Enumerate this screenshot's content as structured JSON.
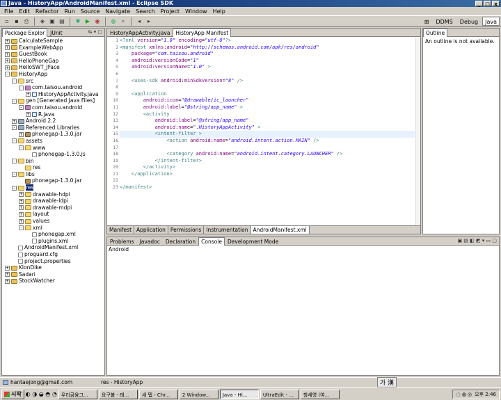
{
  "window": {
    "title": "Java - HistoryApp/AndroidManifest.xml - Eclipse SDK",
    "min": "_",
    "max": "□",
    "close": "x"
  },
  "menu": [
    "File",
    "Edit",
    "Refactor",
    "Run",
    "Source",
    "Navigate",
    "Search",
    "Project",
    "Window",
    "Help"
  ],
  "perspectives": [
    {
      "label": "DDMS",
      "active": false
    },
    {
      "label": "Debug",
      "active": false
    },
    {
      "label": "Java",
      "active": true
    }
  ],
  "package_explorer": {
    "tabs": [
      "Package Explor",
      "JUnit"
    ],
    "tree": [
      {
        "label": "CalculateSample",
        "icon": "proj",
        "depth": 0,
        "exp": "+"
      },
      {
        "label": "ExampleWebApp",
        "icon": "proj",
        "depth": 0,
        "exp": "+"
      },
      {
        "label": "GuestBook",
        "icon": "proj",
        "depth": 0,
        "exp": "+"
      },
      {
        "label": "HelloPhoneGap",
        "icon": "proj",
        "depth": 0,
        "exp": "+"
      },
      {
        "label": "HelloSWT_JFace",
        "icon": "proj",
        "depth": 0,
        "exp": "+"
      },
      {
        "label": "HistoryApp",
        "icon": "proj",
        "depth": 0,
        "exp": "-"
      },
      {
        "label": "src",
        "icon": "folder",
        "depth": 1,
        "exp": "-"
      },
      {
        "label": "com.taisou.android",
        "icon": "pkg",
        "depth": 2,
        "exp": "-"
      },
      {
        "label": "HistoryAppActivity.java",
        "icon": "java",
        "depth": 3,
        "exp": "+"
      },
      {
        "label": "gen [Generated Java Files]",
        "icon": "folder",
        "depth": 1,
        "exp": "-"
      },
      {
        "label": "com.taisou.android",
        "icon": "pkg",
        "depth": 2,
        "exp": "-"
      },
      {
        "label": "R.java",
        "icon": "java",
        "depth": 3,
        "exp": "+"
      },
      {
        "label": "Android 2.2",
        "icon": "lib",
        "depth": 1,
        "exp": "+"
      },
      {
        "label": "Referenced Libraries",
        "icon": "lib",
        "depth": 1,
        "exp": "-"
      },
      {
        "label": "phonegap-1.3.0.jar",
        "icon": "jar",
        "depth": 2,
        "exp": "+"
      },
      {
        "label": "assets",
        "icon": "folder",
        "depth": 1,
        "exp": "-"
      },
      {
        "label": "www",
        "icon": "folder",
        "depth": 2,
        "exp": "-"
      },
      {
        "label": "phonegap-1.3.0.js",
        "icon": "file",
        "depth": 3,
        "exp": ""
      },
      {
        "label": "bin",
        "icon": "folder",
        "depth": 1,
        "exp": "-"
      },
      {
        "label": "res",
        "icon": "folder",
        "depth": 2,
        "exp": ""
      },
      {
        "label": "libs",
        "icon": "folder",
        "depth": 1,
        "exp": "-"
      },
      {
        "label": "phonegap-1.3.0.jar",
        "icon": "jar",
        "depth": 2,
        "exp": ""
      },
      {
        "label": "res",
        "icon": "folder",
        "depth": 1,
        "exp": "-",
        "selected": true
      },
      {
        "label": "drawable-hdpi",
        "icon": "folder",
        "depth": 2,
        "exp": "+"
      },
      {
        "label": "drawable-ldpi",
        "icon": "folder",
        "depth": 2,
        "exp": "+"
      },
      {
        "label": "drawable-mdpi",
        "icon": "folder",
        "depth": 2,
        "exp": "+"
      },
      {
        "label": "layout",
        "icon": "folder",
        "depth": 2,
        "exp": "+"
      },
      {
        "label": "values",
        "icon": "folder",
        "depth": 2,
        "exp": "+"
      },
      {
        "label": "xml",
        "icon": "folder",
        "depth": 2,
        "exp": "-"
      },
      {
        "label": "phonegap.xml",
        "icon": "file",
        "depth": 3,
        "exp": ""
      },
      {
        "label": "plugins.xml",
        "icon": "file",
        "depth": 3,
        "exp": ""
      },
      {
        "label": "AndroidManifest.xml",
        "icon": "file",
        "depth": 1,
        "exp": ""
      },
      {
        "label": "proguard.cfg",
        "icon": "file",
        "depth": 1,
        "exp": ""
      },
      {
        "label": "project.properties",
        "icon": "file",
        "depth": 1,
        "exp": ""
      },
      {
        "label": "KlonDike",
        "icon": "proj",
        "depth": 0,
        "exp": "+"
      },
      {
        "label": "Sadari",
        "icon": "proj",
        "depth": 0,
        "exp": "+"
      },
      {
        "label": "StockWatcher",
        "icon": "proj",
        "depth": 0,
        "exp": "+"
      }
    ]
  },
  "editor": {
    "tabs": [
      {
        "label": "HistoryAppActivity.java",
        "active": false
      },
      {
        "label": "HistoryApp Manifest",
        "active": true
      }
    ],
    "line_numbers": [
      "1",
      "2",
      "3",
      "4",
      "5",
      "6",
      "7",
      "8",
      "9",
      "10",
      "11",
      "12",
      "13",
      "14",
      "15",
      "16",
      "17",
      "18",
      "19",
      "20",
      "21",
      "22",
      "23"
    ],
    "lines": [
      [
        {
          "t": "<?xml ",
          "c": "pi"
        },
        {
          "t": "version",
          "c": "attr"
        },
        {
          "t": "=",
          "c": ""
        },
        {
          "t": "\"1.0\"",
          "c": "val"
        },
        {
          "t": " ",
          "c": ""
        },
        {
          "t": "encoding",
          "c": "attr"
        },
        {
          "t": "=",
          "c": ""
        },
        {
          "t": "\"utf-8\"",
          "c": "val"
        },
        {
          "t": "?>",
          "c": "pi"
        }
      ],
      [
        {
          "t": "<manifest ",
          "c": "tag"
        },
        {
          "t": "xmlns:android",
          "c": "attr"
        },
        {
          "t": "=",
          "c": ""
        },
        {
          "t": "\"http://schemas.android.com/apk/res/android\"",
          "c": "val"
        }
      ],
      [
        {
          "t": "    package",
          "c": "attr"
        },
        {
          "t": "=",
          "c": ""
        },
        {
          "t": "\"com.taisou.android\"",
          "c": "val"
        }
      ],
      [
        {
          "t": "    android:versionCode",
          "c": "attr"
        },
        {
          "t": "=",
          "c": ""
        },
        {
          "t": "\"1\"",
          "c": "val"
        }
      ],
      [
        {
          "t": "    android:versionName",
          "c": "attr"
        },
        {
          "t": "=",
          "c": ""
        },
        {
          "t": "\"1.0\"",
          "c": "val"
        },
        {
          "t": " >",
          "c": "tag"
        }
      ],
      [],
      [
        {
          "t": "    <uses-sdk ",
          "c": "tag"
        },
        {
          "t": "android:minSdkVersion",
          "c": "attr"
        },
        {
          "t": "=",
          "c": ""
        },
        {
          "t": "\"8\"",
          "c": "val"
        },
        {
          "t": " />",
          "c": "tag"
        }
      ],
      [],
      [
        {
          "t": "    <application",
          "c": "tag"
        }
      ],
      [
        {
          "t": "        android:icon",
          "c": "attr"
        },
        {
          "t": "=",
          "c": ""
        },
        {
          "t": "\"@drawable/ic_launcher\"",
          "c": "val"
        }
      ],
      [
        {
          "t": "        android:label",
          "c": "attr"
        },
        {
          "t": "=",
          "c": ""
        },
        {
          "t": "\"@string/app_name\"",
          "c": "val"
        },
        {
          "t": " >",
          "c": "tag"
        }
      ],
      [
        {
          "t": "        <activity",
          "c": "tag"
        }
      ],
      [
        {
          "t": "            android:label",
          "c": "attr"
        },
        {
          "t": "=",
          "c": ""
        },
        {
          "t": "\"@string/app_name\"",
          "c": "val"
        }
      ],
      [
        {
          "t": "            android:name",
          "c": "attr"
        },
        {
          "t": "=",
          "c": ""
        },
        {
          "t": "\".HistoryAppActivity\"",
          "c": "val"
        },
        {
          "t": " >",
          "c": "tag"
        }
      ],
      [
        {
          "t": "            <intent-filter >",
          "c": "tag"
        }
      ],
      [
        {
          "t": "                <action ",
          "c": "tag"
        },
        {
          "t": "android:name",
          "c": "attr"
        },
        {
          "t": "=",
          "c": ""
        },
        {
          "t": "\"android.intent.action.MAIN\"",
          "c": "val"
        },
        {
          "t": " />",
          "c": "tag"
        }
      ],
      [],
      [
        {
          "t": "                <category ",
          "c": "tag"
        },
        {
          "t": "android:name",
          "c": "attr"
        },
        {
          "t": "=",
          "c": ""
        },
        {
          "t": "\"android.intent.category.LAUNCHER\"",
          "c": "val"
        },
        {
          "t": " />",
          "c": "tag"
        }
      ],
      [
        {
          "t": "            </intent-filter>",
          "c": "tag"
        }
      ],
      [
        {
          "t": "        </activity>",
          "c": "tag"
        }
      ],
      [
        {
          "t": "    </application>",
          "c": "tag"
        }
      ],
      [],
      [
        {
          "t": "</manifest>",
          "c": "tag"
        }
      ]
    ],
    "highlight_line": 15,
    "bottom_tabs": [
      {
        "label": "Manifest",
        "active": false
      },
      {
        "label": "Application",
        "active": false
      },
      {
        "label": "Permissions",
        "active": false
      },
      {
        "label": "Instrumentation",
        "active": false
      },
      {
        "label": "AndroidManifest.xml",
        "active": true
      }
    ]
  },
  "outline": {
    "tab": "Outline",
    "message": "An outline is not available."
  },
  "bottom_panel": {
    "tabs": [
      {
        "label": "Problems",
        "active": false
      },
      {
        "label": "Javadoc",
        "active": false
      },
      {
        "label": "Declaration",
        "active": false
      },
      {
        "label": "Console",
        "active": true
      },
      {
        "label": "Development Mode",
        "active": false
      }
    ],
    "console_title": "Android"
  },
  "status": {
    "account": "hantaejong@gmail.com",
    "selection": "res - HistoryApp",
    "ime": "가 漢"
  },
  "taskbar": {
    "start": "시작",
    "tasks": [
      {
        "label": "우리금융그...",
        "active": false
      },
      {
        "label": "요구불 - 태...",
        "active": false
      },
      {
        "label": "새 탭 - Chr...",
        "active": false
      },
      {
        "label": "2 Window...",
        "active": false
      },
      {
        "label": "Java - Hi...",
        "active": true
      },
      {
        "label": "UltraEdit - ...",
        "active": false
      },
      {
        "label": "항세영 (여...",
        "active": false
      }
    ],
    "clock": "오후 2:46"
  }
}
